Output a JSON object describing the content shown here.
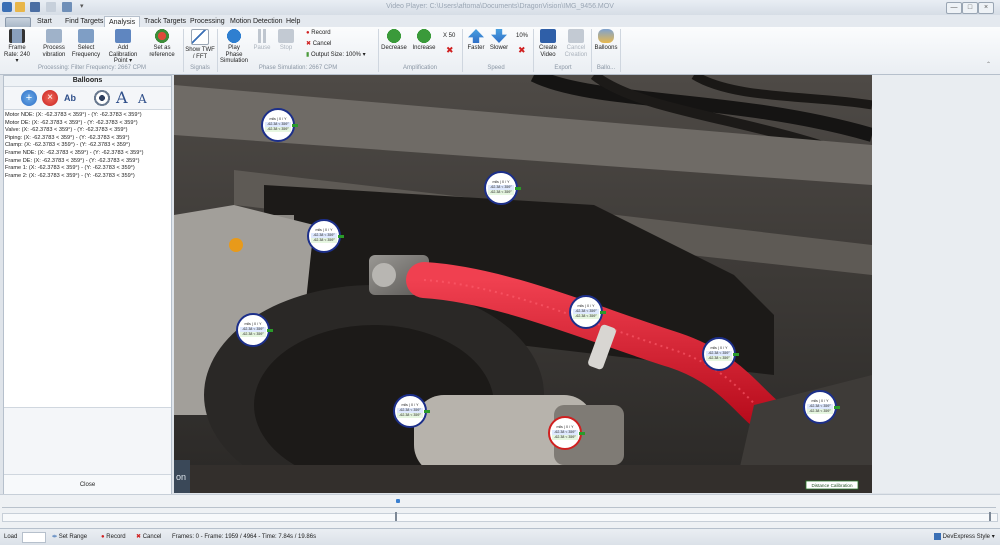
{
  "window": {
    "title": "Video Player: C:\\Users\\aftoma\\Documents\\DragonVision\\IMG_9456.MOV",
    "controls": [
      "—",
      "□",
      "×"
    ]
  },
  "menu_tabs": [
    "Start",
    "Find Targets",
    "Analysis",
    "Track Targets",
    "Processing",
    "Motion Detection",
    "Help"
  ],
  "active_tab": "Analysis",
  "ribbon": {
    "frame_rate": {
      "line1": "Frame",
      "line2": "Rate: 240 ▾"
    },
    "process_vibration": {
      "line1": "Process",
      "line2": "vibration"
    },
    "select_frequency": {
      "line1": "Select",
      "line2": "Frequency"
    },
    "add_calibration": {
      "line1": "Add Calibration",
      "line2": "Point ▾"
    },
    "set_reference": {
      "line1": "Set as",
      "line2": "reference"
    },
    "show_twf": {
      "line1": "Show TWF",
      "line2": "/ FFT"
    },
    "play_phase": {
      "line1": "Play Phase",
      "line2": "Simulation"
    },
    "pause": "Pause",
    "stop": "Stop",
    "record": "Record",
    "cancel": "Cancel",
    "output_size": "Output Size: 100% ▾",
    "decrease": "Decrease",
    "increase": "Increase",
    "amp_factor": "X 50",
    "faster": "Faster",
    "slower": "Slower",
    "speed_pct": "10%",
    "create_video": {
      "line1": "Create",
      "line2": "Video"
    },
    "cancel_creation": {
      "line1": "Cancel",
      "line2": "Creation"
    },
    "balloons": "Balloons",
    "groups": {
      "processing": "Processing: Filter Frequency: 2667 CPM",
      "signals": "Signals",
      "phase": "Phase Simulation: 2667 CPM",
      "amplification": "Amplification",
      "speed": "Speed",
      "export": "Export",
      "balloons": "Ballo..."
    }
  },
  "panel": {
    "title": "Balloons",
    "items": [
      "Motor NDE: (X: -62.3783 < 359°) - (Y: -62.3783 < 359°)",
      "Motor DE: (X: -62.3783 < 359°) - (Y: -62.3783 < 359°)",
      "Valve: (X: -62.3783 < 359°) - (Y: -62.3783 < 359°)",
      "Piping: (X: -62.3783 < 359°) - (Y: -62.3783 < 359°)",
      "Clamp: (X: -62.3783 < 359°) - (Y: -62.3783 < 359°)",
      "Frame NDE: (X: -62.3783 < 359°) - (Y: -62.3783 < 359°)",
      "Frame DE: (X: -62.3783 < 359°) - (Y: -62.3783 < 359°)",
      "Frame 1: (X: -62.3783 < 359°) - (Y: -62.3783 < 359°)",
      "Frame 2: (X: -62.3783 < 359°) - (Y: -62.3783 < 359°)"
    ],
    "close": "Close"
  },
  "balloons": {
    "header": "mils | X / Y",
    "val1": "-62.38 < 359°",
    "val2": "-62.38 < 359°"
  },
  "video": {
    "calibration_label": "Distance Calibration",
    "logo_text": "on"
  },
  "status": {
    "load": "Load",
    "set_range": "Set Range",
    "record": "Record",
    "cancel": "Cancel",
    "frames_info": "Frames: 0 - Frame: 1959 / 4964 - Time: 7.84s / 19.86s",
    "theme": "DevExpress Style ▾"
  },
  "colors": {
    "accent": "#2f6fc7",
    "balloon_border": "#1c2f8a",
    "balloon_alert": "#d02020",
    "hose": "#e0182a"
  }
}
